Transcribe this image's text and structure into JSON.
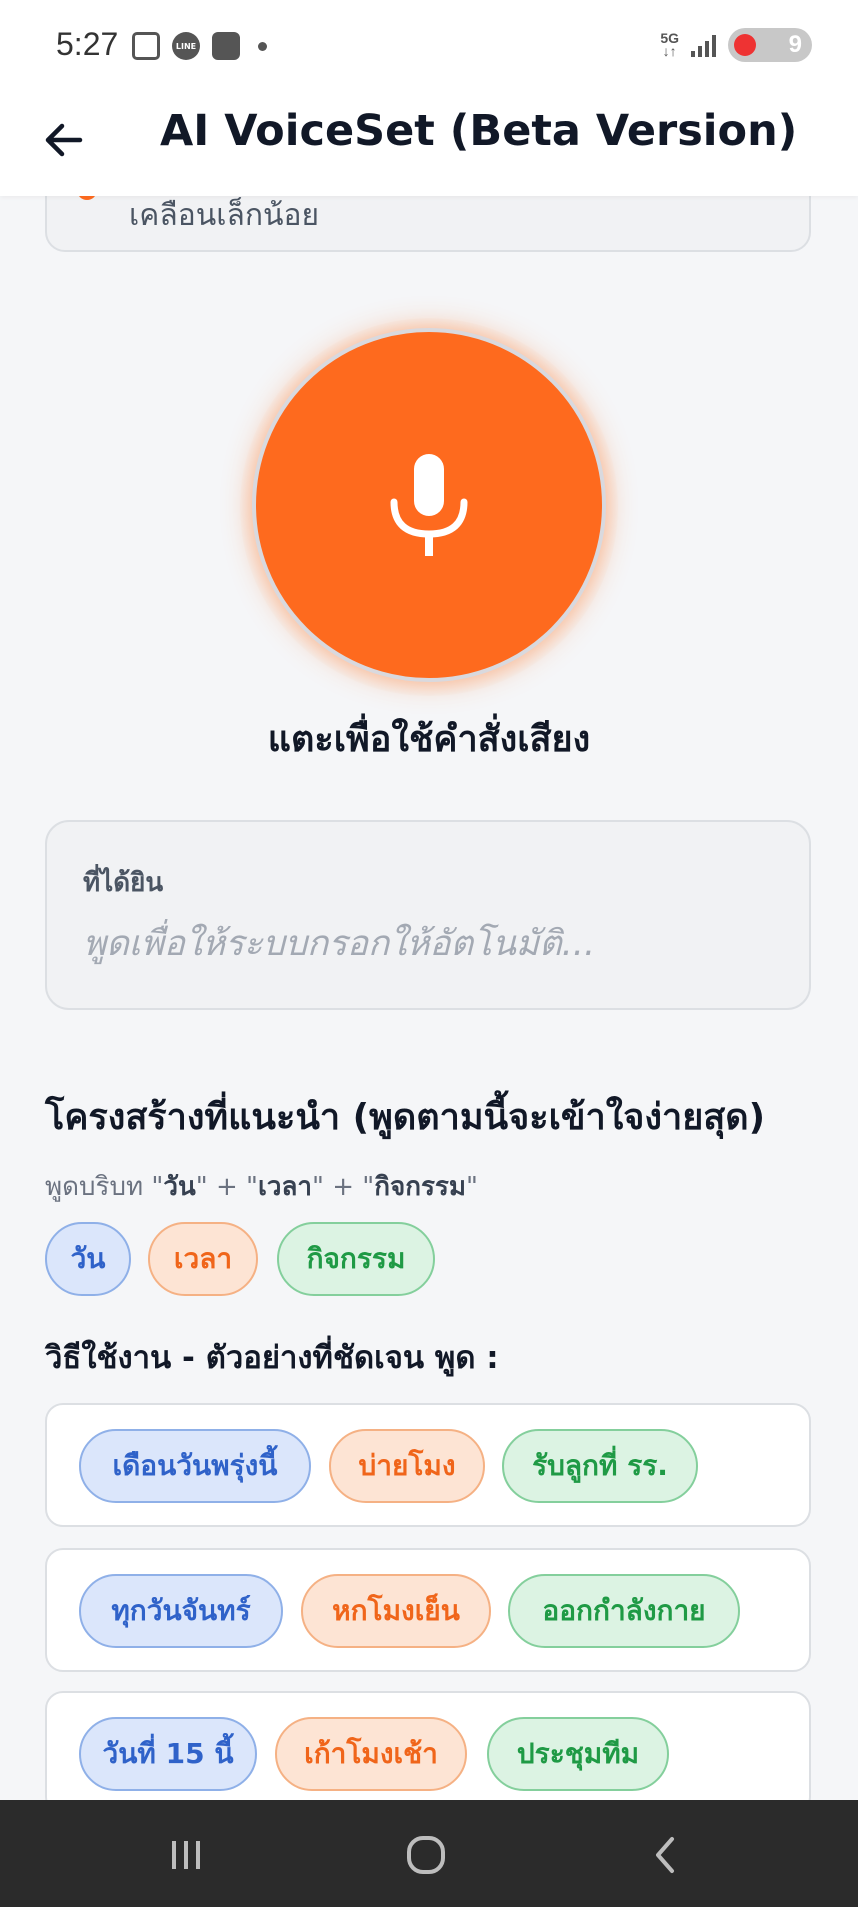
{
  "status": {
    "time": "5:27",
    "network": "5G",
    "battery": "9"
  },
  "header": {
    "title": "AI VoiceSet (Beta Version)"
  },
  "tip": {
    "text": "เคลือนเล็กน้อย"
  },
  "voice": {
    "tap_label": "แตะเพื่อใช้คำสั่งเสียง"
  },
  "heard": {
    "label": "ที่ได้ยิน",
    "placeholder": "พูดเพื่อให้ระบบกรอกให้อัตโนมัติ..."
  },
  "structure": {
    "title": "โครงสร้างที่แนะนำ (พูดตามนี้จะเข้าใจง่ายสุด)",
    "hint_prefix": "พูดบริบท \"",
    "hint_day": "วัน",
    "hint_mid1": "\" + \"",
    "hint_time": "เวลา",
    "hint_mid2": "\" + \"",
    "hint_activity": "กิจกรรม",
    "hint_suffix": "\"",
    "chips": [
      "วัน",
      "เวลา",
      "กิจกรรม"
    ]
  },
  "usage": {
    "title": "วิธีใช้งาน - ตัวอย่างที่ชัดเจน พูด :",
    "examples": [
      [
        "เดือนวันพรุ่งนี้",
        "บ่ายโมง",
        "รับลูกที่ รร."
      ],
      [
        "ทุกวันจันทร์",
        "หกโมงเย็น",
        "ออกกำลังกาย"
      ],
      [
        "วันที่ 15 นี้",
        "เก้าโมงเช้า",
        "ประชุมทีม"
      ]
    ]
  },
  "colors": {
    "accent": "#fe6a1e",
    "day_chip": "#2f62c9",
    "time_chip": "#f0651a",
    "activity_chip": "#1f9a45"
  }
}
